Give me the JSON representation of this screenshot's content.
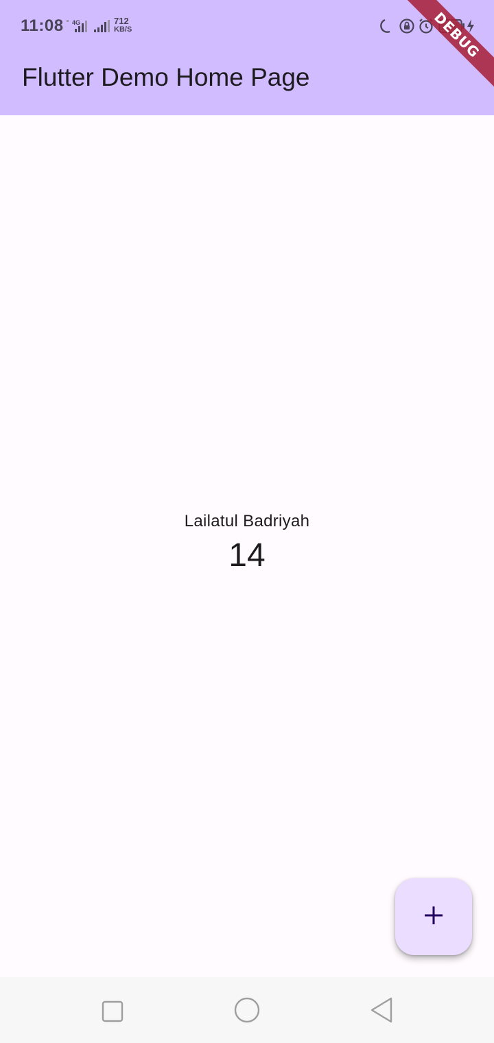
{
  "status_bar": {
    "time": "11:08",
    "network_type": "4G",
    "speed_value": "712",
    "speed_unit": "KB/S",
    "icons": [
      "signal-4g-icon",
      "signal-icon",
      "moon-icon",
      "rotation-lock-icon",
      "alarm-icon",
      "battery-icon",
      "charging-icon"
    ],
    "color": "#4a4458"
  },
  "app_bar": {
    "title": "Flutter Demo Home Page",
    "background": "#d1bcff"
  },
  "debug_banner": {
    "label": "DEBUG"
  },
  "main": {
    "name_label": "Lailatul Badriyah",
    "counter_value": "14"
  },
  "fab": {
    "icon": "plus-icon",
    "background": "#eaddff"
  },
  "nav_bar": {
    "buttons": [
      "recents-square-icon",
      "home-circle-icon",
      "back-triangle-icon"
    ]
  },
  "colors": {
    "page_background": "#fffbff",
    "nav_background": "#f7f7f7",
    "debug_ribbon": "#a81e37"
  }
}
